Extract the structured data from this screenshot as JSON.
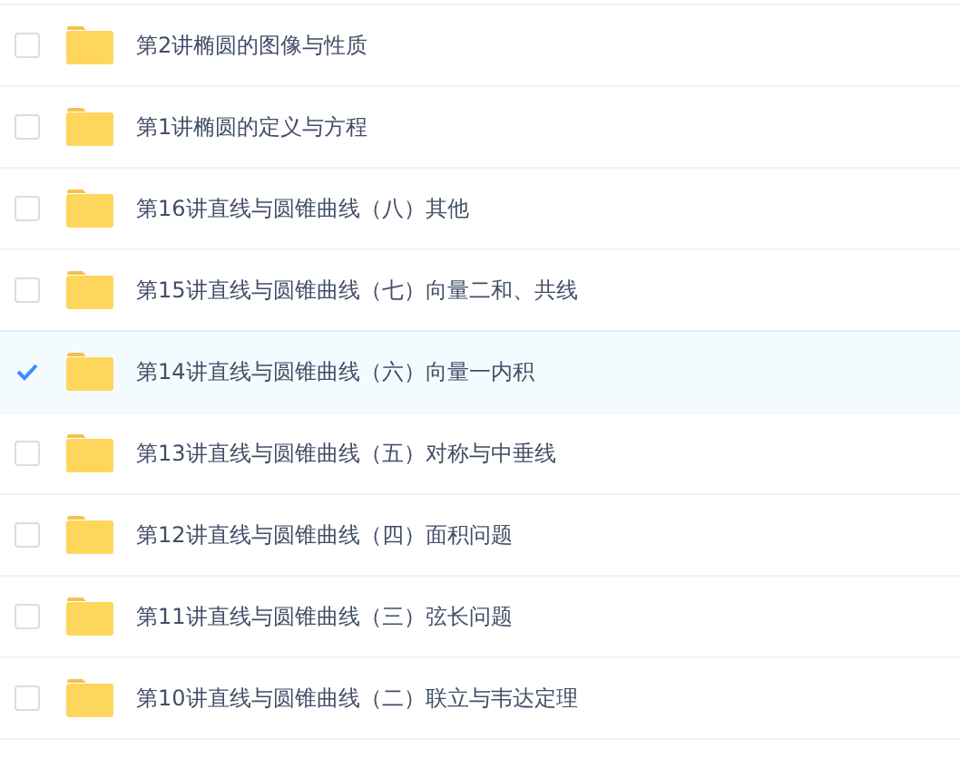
{
  "files": [
    {
      "name": "第2讲椭圆的图像与性质",
      "selected": false
    },
    {
      "name": "第1讲椭圆的定义与方程",
      "selected": false
    },
    {
      "name": "第16讲直线与圆锥曲线（八）其他",
      "selected": false
    },
    {
      "name": "第15讲直线与圆锥曲线（七）向量二和、共线",
      "selected": false
    },
    {
      "name": "第14讲直线与圆锥曲线（六）向量一内积",
      "selected": true
    },
    {
      "name": "第13讲直线与圆锥曲线（五）对称与中垂线",
      "selected": false
    },
    {
      "name": "第12讲直线与圆锥曲线（四）面积问题",
      "selected": false
    },
    {
      "name": "第11讲直线与圆锥曲线（三）弦长问题",
      "selected": false
    },
    {
      "name": "第10讲直线与圆锥曲线（二）联立与韦达定理",
      "selected": false
    }
  ]
}
